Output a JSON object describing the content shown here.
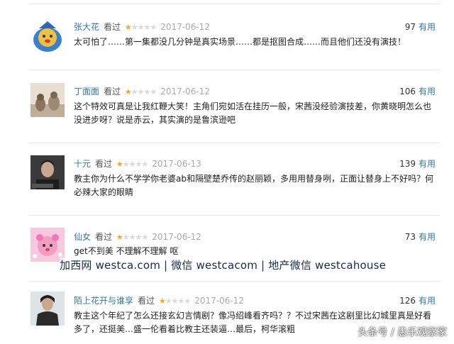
{
  "comments": [
    {
      "user": "张大花",
      "status": "看过",
      "rating": 1,
      "date": "2017-06-12",
      "votes": "97",
      "useful": "有用",
      "text": "太可怕了……第一集都没几分钟是真实场景……都是抠图合成……而且他们还没有演技！"
    },
    {
      "user": "丁面面",
      "status": "看过",
      "rating": 1,
      "date": "2017-06-12",
      "votes": "106",
      "useful": "有用",
      "text": "这个特效可真是让我红鞭大笑！主角们宛如活在挂历一般，宋茜没经验演技差，你黄晓明怎么也没进步呀？说是赤云，其实演的是鲁滨逊吧"
    },
    {
      "user": "十元",
      "status": "看过",
      "rating": 1,
      "date": "2017-06-13",
      "votes": "139",
      "useful": "有用",
      "text": "教主你为什么不学学你老婆ab和隔壁楚乔传的赵丽颖，多用用替身咧，正面让替身上不好吗？何必辣大家的眼睛"
    },
    {
      "user": "仙女",
      "status": "看过",
      "rating": 1,
      "date": "2017-06-12",
      "votes": "73",
      "useful": "有用",
      "text": "get不到美 不理解不理解 呕"
    },
    {
      "user": "陌上花开与谁享",
      "status": "看过",
      "rating": 1,
      "date": "2017-06-12",
      "votes": "126",
      "useful": "有用",
      "text": "教主这个年纪了怎么还接玄幻言情剧？像冯绍峰看齐吗？？不过宋茜在这剧里比幻城里真是好看多了，还挺美…盛一伦看着比教主还装逼…最后，柯华滚粗"
    }
  ],
  "watermark": "加西网 westca.com | 微信 westcacom | 地产微信 westcahouse",
  "brand": "头条号 / 愚乐观察家",
  "colors": {
    "link": "#3377aa",
    "star_on": "#f5a623",
    "star_off": "#d9d9d9",
    "date": "#aaaaaa"
  }
}
